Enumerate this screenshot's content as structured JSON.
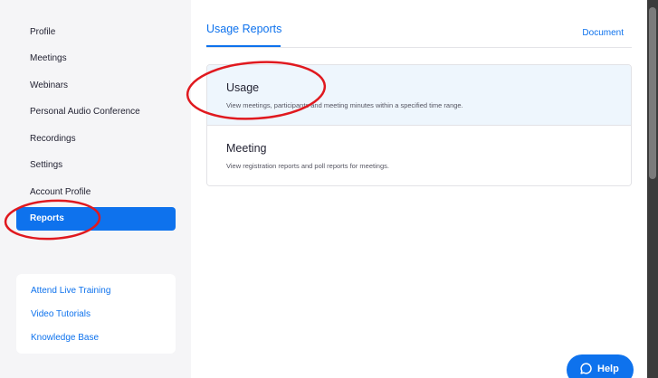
{
  "sidebar": {
    "items": [
      {
        "label": "Profile"
      },
      {
        "label": "Meetings"
      },
      {
        "label": "Webinars"
      },
      {
        "label": "Personal Audio Conference"
      },
      {
        "label": "Recordings"
      },
      {
        "label": "Settings"
      },
      {
        "label": "Account Profile"
      },
      {
        "label": "Reports",
        "active": true
      }
    ],
    "help_links": [
      {
        "label": "Attend Live Training"
      },
      {
        "label": "Video Tutorials"
      },
      {
        "label": "Knowledge Base"
      }
    ]
  },
  "main": {
    "tab": {
      "label": "Usage Reports"
    },
    "document_link": "Document",
    "cards": [
      {
        "title": "Usage",
        "description": "View meetings, participants and meeting minutes within a specified time range."
      },
      {
        "title": "Meeting",
        "description": "View registration reports and poll reports for meetings."
      }
    ]
  },
  "help_button": {
    "label": "Help",
    "icon": "chat-bubble-icon"
  },
  "colors": {
    "accent": "#0e72ed",
    "sidebar_bg": "#f5f5f7",
    "annotation": "#e0191f"
  }
}
